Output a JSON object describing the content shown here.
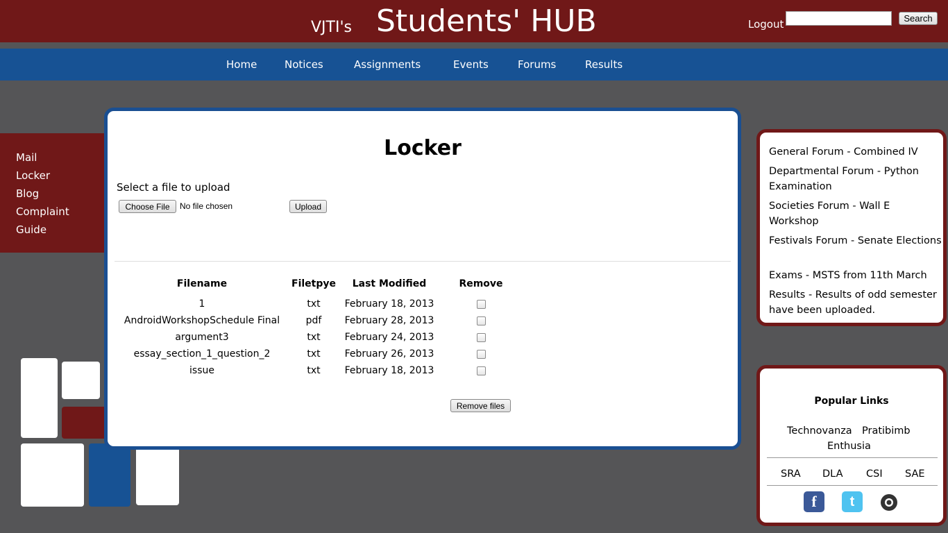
{
  "header": {
    "brand_small": "VJTI's",
    "brand_big": "Students' HUB",
    "logout": "Logout",
    "search_value": "",
    "search_button": "Search"
  },
  "nav": [
    "Home",
    "Notices",
    "Assignments",
    "Events",
    "Forums",
    "Results"
  ],
  "sidebar": [
    "Mail",
    "Locker",
    "Blog",
    "Complaint",
    "Guide"
  ],
  "main": {
    "title": "Locker",
    "upload_label": "Select a file to upload",
    "choose_button": "Choose File",
    "no_file_text": "No file chosen",
    "upload_button": "Upload",
    "table": {
      "headers": [
        "Filename",
        "Filetpye",
        "Last Modified",
        "Remove"
      ],
      "rows": [
        {
          "filename": "1",
          "type": "txt",
          "modified": "February 18, 2013"
        },
        {
          "filename": "AndroidWorkshopSchedule Final",
          "type": "pdf",
          "modified": "February 28, 2013"
        },
        {
          "filename": "argument3",
          "type": "txt",
          "modified": "February 24, 2013"
        },
        {
          "filename": "essay_section_1_question_2",
          "type": "txt",
          "modified": "February 26, 2013"
        },
        {
          "filename": "issue",
          "type": "txt",
          "modified": "February 18, 2013"
        }
      ]
    },
    "remove_button": "Remove files"
  },
  "forums": [
    "General Forum - Combined IV",
    "Departmental Forum - Python Examination",
    "Societies Forum - Wall E Workshop",
    "Festivals Forum - Senate Elections",
    "Exams - MSTS from 11th March",
    "Results - Results of odd semester have been uploaded."
  ],
  "popular": {
    "title": "Popular Links",
    "links": [
      "Technovanza",
      "Pratibimb",
      "Enthusia"
    ],
    "clubs": [
      "SRA",
      "DLA",
      "CSI",
      "SAE"
    ],
    "social": [
      "facebook-icon",
      "twitter-icon",
      "github-icon"
    ]
  },
  "colors": {
    "maroon": "#701818",
    "blue": "#175294",
    "background": "#555557"
  }
}
